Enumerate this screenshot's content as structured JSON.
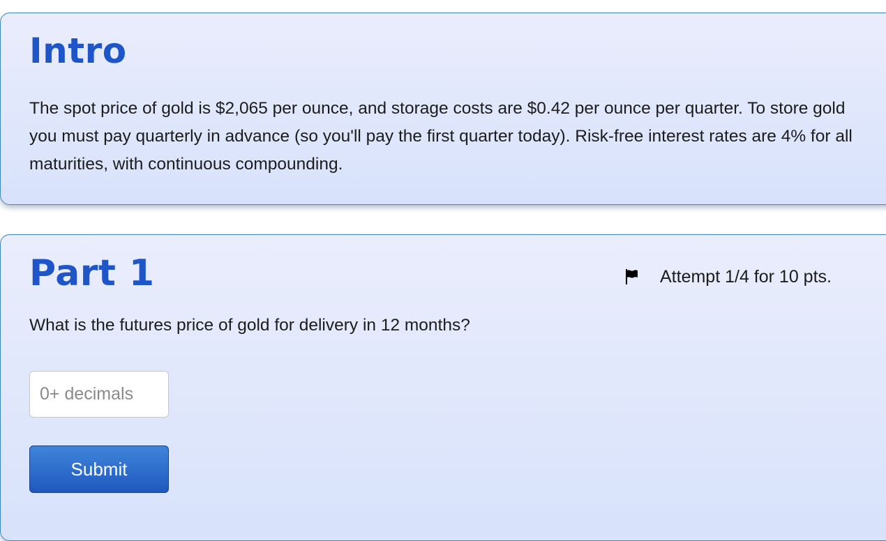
{
  "intro": {
    "title": "Intro",
    "text": "The spot price of gold is $2,065 per ounce, and storage costs are $0.42 per ounce per quarter. To store gold you must pay quarterly in advance (so you'll pay the first quarter today). Risk-free interest rates are 4% for all maturities, with continuous compounding."
  },
  "part1": {
    "title": "Part 1",
    "attempt_text": "Attempt 1/4 for 10 pts.",
    "flag_icon": "flag-icon",
    "question": "What is the futures price of gold for delivery in 12 months?",
    "answer": {
      "value": "",
      "placeholder": "0+ decimals"
    },
    "submit_label": "Submit"
  },
  "colors": {
    "title": "#1e55c8",
    "card_border": "#3d84c0",
    "button": "#2a67c9"
  }
}
